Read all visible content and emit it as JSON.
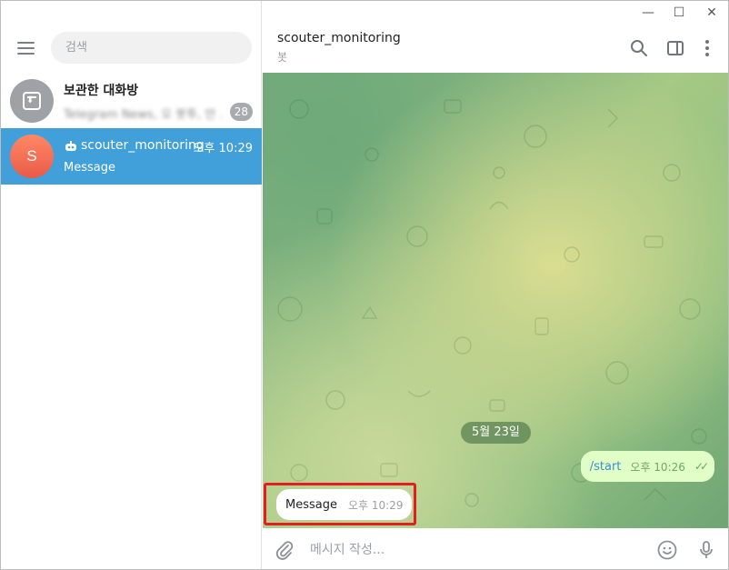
{
  "window": {
    "controls": [
      "—",
      "☐",
      "✕"
    ]
  },
  "sidebar": {
    "search_placeholder": "검색",
    "chats": [
      {
        "title": "보관한 대화방",
        "preview": "Telegram News, 오 봇투, 안 ...",
        "unread": "28"
      },
      {
        "title": "scouter_monitoring",
        "time": "오후 10:29",
        "preview": "Message",
        "avatar_letter": "S"
      }
    ]
  },
  "chat": {
    "title": "scouter_monitoring",
    "subtitle": "봇",
    "date": "5월 23일",
    "messages": [
      {
        "direction": "out",
        "text": "/start",
        "time": "오후 10:26"
      },
      {
        "direction": "in",
        "text": "Message",
        "time": "오후 10:29"
      }
    ],
    "composer_placeholder": "메시지 작성..."
  },
  "colors": {
    "accent": "#419fd9",
    "outgoing_bubble": "#e1fec6",
    "highlight": "#e02020"
  }
}
